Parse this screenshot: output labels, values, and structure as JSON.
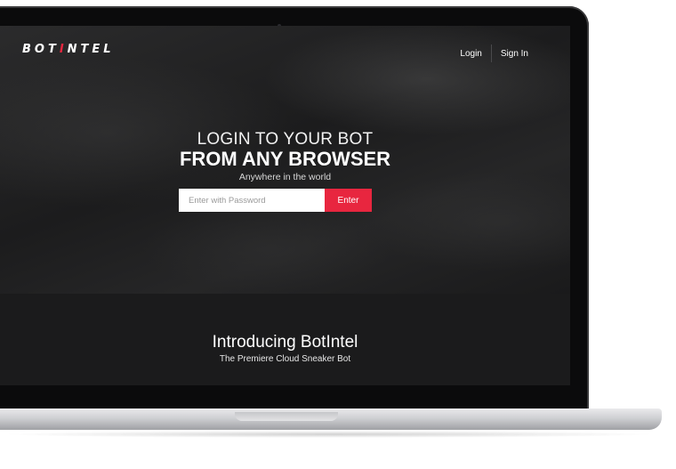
{
  "brand": {
    "prefix": "BOT",
    "accent": "I",
    "suffix": "NTEL"
  },
  "nav": {
    "login": "Login",
    "signin": "Sign In"
  },
  "hero": {
    "headline_1": "LOGIN TO YOUR BOT",
    "headline_2": "FROM ANY BROWSER",
    "tagline": "Anywhere in the world",
    "password_placeholder": "Enter with Password",
    "enter_label": "Enter"
  },
  "intro": {
    "title": "Introducing BotIntel",
    "subtitle": "The Premiere Cloud Sneaker Bot"
  },
  "colors": {
    "accent": "#e8263f",
    "background": "#1b1b1c"
  }
}
